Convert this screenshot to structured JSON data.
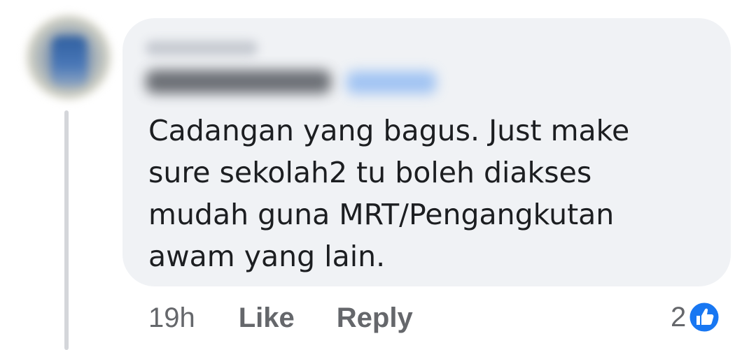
{
  "comment": {
    "text": "Cadangan yang bagus. Just make sure sekolah2 tu boleh diakses mudah guna MRT/Pengangkutan awam yang lain.",
    "lines": [
      "Cadangan yang bagus. Just make",
      "sure sekolah2 tu boleh diakses",
      "mudah guna MRT/Pengangkutan",
      "awam yang lain."
    ],
    "timestamp": "19h",
    "like_label": "Like",
    "reply_label": "Reply",
    "reaction_count": "2",
    "reaction_icon": "thumbs-up-icon",
    "reaction_color": "#1877f2"
  },
  "colors": {
    "bubble_bg": "#f0f2f5",
    "text": "#1c1e21",
    "secondary_text": "#65676b",
    "thread_line": "#d4d6da"
  }
}
